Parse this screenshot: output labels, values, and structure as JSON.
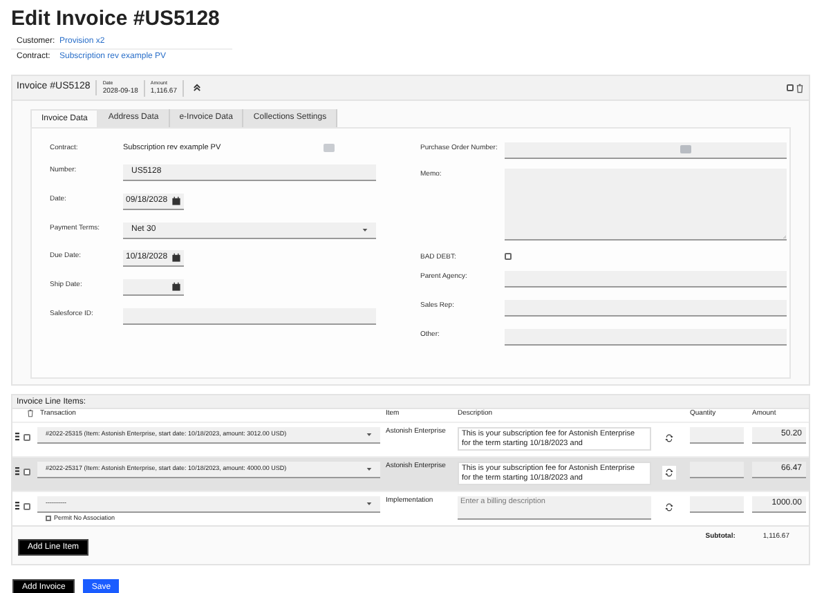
{
  "page_title": "Edit Invoice #US5128",
  "meta": [
    {
      "label": "Customer:",
      "value": "Provision x2"
    },
    {
      "label": "Contract:",
      "value": "Subscription rev example PV"
    }
  ],
  "invoice_bar": {
    "title": "Invoice #US5128",
    "select_checked": false,
    "stats": [
      {
        "label": "Date",
        "value": "2028-09-18"
      },
      {
        "label": "Amount",
        "value": "1,116.67"
      }
    ]
  },
  "tabs": [
    {
      "label": "Invoice Data",
      "selected": true
    },
    {
      "label": "Address Data",
      "selected": false
    },
    {
      "label": "e-Invoice Data",
      "selected": false
    },
    {
      "label": "Collections Settings",
      "selected": false
    }
  ],
  "form": {
    "left": [
      {
        "kind": "text",
        "label": "Contract:",
        "value": "Subscription rev example PV"
      },
      {
        "kind": "input",
        "label": "Number:",
        "value": "US5128"
      },
      {
        "kind": "date",
        "label": "Date:",
        "value": "09/18/2028"
      },
      {
        "kind": "select",
        "label": "Payment Terms:",
        "value": "Net 30"
      },
      {
        "kind": "date",
        "label": "Due Date:",
        "value": "10/18/2028"
      },
      {
        "kind": "date",
        "label": "Ship Date:"
      },
      {
        "kind": "input",
        "label": "Salesforce ID:"
      }
    ],
    "right": [
      {
        "kind": "lookup",
        "label": "Purchase Order Number:"
      },
      {
        "kind": "textarea",
        "label": "Memo:"
      },
      {
        "kind": "checkbox",
        "label": "BAD DEBT:",
        "checked": false
      },
      {
        "kind": "input",
        "label": "Parent Agency:"
      },
      {
        "kind": "input",
        "label": "Sales Rep:"
      },
      {
        "kind": "input",
        "label": "Other:"
      }
    ]
  },
  "line_items": {
    "title": "Invoice Line Items:",
    "columns": [
      "Transaction",
      "Item",
      "Description",
      "Quantity",
      "Amount"
    ],
    "rows": [
      {
        "checked": false,
        "highlighted": false,
        "transaction": "#2022-25315 (Item: Astonish Enterprise, start date: 10/18/2023, amount: 3012.00 USD)",
        "item": "Astonish Enterprise",
        "description": "This is your subscription fee for Astonish Enterprise for the term starting 10/18/2023 and",
        "amount": "50.20"
      },
      {
        "checked": false,
        "highlighted": true,
        "transaction": "#2022-25317 (Item: Astonish Enterprise, start date: 10/18/2023, amount: 4000.00 USD)",
        "item": "Astonish Enterprise",
        "description": "This is your subscription fee for Astonish Enterprise for the term starting 10/18/2023 and",
        "amount": "66.47"
      },
      {
        "checked": false,
        "highlighted": false,
        "transaction": "----------",
        "permit_label": "Permit No Association",
        "permit_checked": false,
        "item": "Implementation",
        "description_placeholder": "Enter a billing description",
        "amount": "1000.00"
      }
    ],
    "add_button": "Add Line Item",
    "subtotal": {
      "label": "Subtotal:",
      "value": "1,116.67"
    }
  },
  "buttons": [
    {
      "kind": "dark",
      "label": "Add Invoice"
    },
    {
      "kind": "primary",
      "label": "Save"
    }
  ]
}
